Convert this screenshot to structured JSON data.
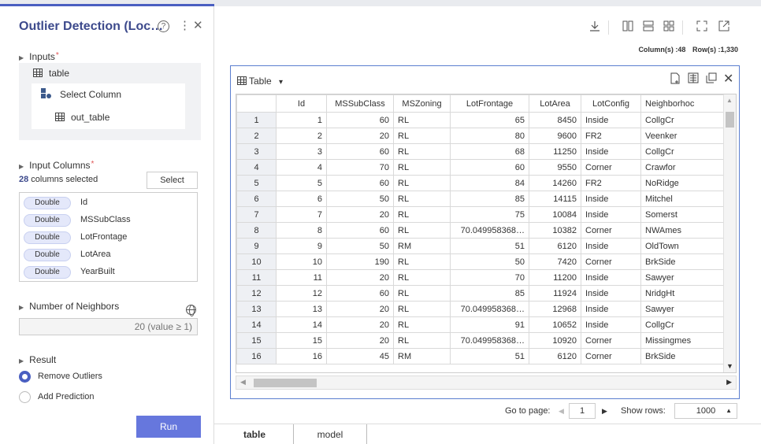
{
  "panel": {
    "title": "Outlier Detection (Loc…",
    "help_glyph": "?",
    "more_glyph": "⋮",
    "close_glyph": "✕",
    "inputs": {
      "label": "Inputs",
      "tree": {
        "root": "table",
        "node": "Select Column",
        "leaf": "out_table"
      }
    },
    "input_columns": {
      "label": "Input Columns",
      "count": "28",
      "count_suffix": " columns selected",
      "select_label": "Select",
      "items": [
        {
          "type": "Double",
          "name": "Id"
        },
        {
          "type": "Double",
          "name": "MSSubClass"
        },
        {
          "type": "Double",
          "name": "LotFrontage"
        },
        {
          "type": "Double",
          "name": "LotArea"
        },
        {
          "type": "Double",
          "name": "YearBuilt"
        }
      ]
    },
    "neighbors": {
      "label": "Number of Neighbors",
      "placeholder": "20 (value ≥ 1)"
    },
    "result": {
      "label": "Result",
      "options": [
        {
          "label": "Remove Outliers",
          "selected": true
        },
        {
          "label": "Add Prediction",
          "selected": false
        }
      ]
    },
    "run_label": "Run",
    "required_mark": "*"
  },
  "toolbar": {
    "icons": [
      "download-icon",
      "columns-layout-icon",
      "rows-layout-icon",
      "grid-layout-icon",
      "expand-icon",
      "popout-icon"
    ],
    "columns_label": "Column(s) :48",
    "rows_label": "Row(s) :1,330"
  },
  "table_view": {
    "title": "Table",
    "dropdown_glyph": "▾",
    "headers": [
      "",
      "Id",
      "MSSubClass",
      "MSZoning",
      "LotFrontage",
      "LotArea",
      "LotConfig",
      "Neighborhoc"
    ],
    "rows": [
      [
        "1",
        "1",
        "60",
        "RL",
        "65",
        "8450",
        "Inside",
        "CollgCr"
      ],
      [
        "2",
        "2",
        "20",
        "RL",
        "80",
        "9600",
        "FR2",
        "Veenker"
      ],
      [
        "3",
        "3",
        "60",
        "RL",
        "68",
        "11250",
        "Inside",
        "CollgCr"
      ],
      [
        "4",
        "4",
        "70",
        "RL",
        "60",
        "9550",
        "Corner",
        "Crawfor"
      ],
      [
        "5",
        "5",
        "60",
        "RL",
        "84",
        "14260",
        "FR2",
        "NoRidge"
      ],
      [
        "6",
        "6",
        "50",
        "RL",
        "85",
        "14115",
        "Inside",
        "Mitchel"
      ],
      [
        "7",
        "7",
        "20",
        "RL",
        "75",
        "10084",
        "Inside",
        "Somerst"
      ],
      [
        "8",
        "8",
        "60",
        "RL",
        "70.049958368…",
        "10382",
        "Corner",
        "NWAmes"
      ],
      [
        "9",
        "9",
        "50",
        "RM",
        "51",
        "6120",
        "Inside",
        "OldTown"
      ],
      [
        "10",
        "10",
        "190",
        "RL",
        "50",
        "7420",
        "Corner",
        "BrkSide"
      ],
      [
        "11",
        "11",
        "20",
        "RL",
        "70",
        "11200",
        "Inside",
        "Sawyer"
      ],
      [
        "12",
        "12",
        "60",
        "RL",
        "85",
        "11924",
        "Inside",
        "NridgHt"
      ],
      [
        "13",
        "13",
        "20",
        "RL",
        "70.049958368…",
        "12968",
        "Inside",
        "Sawyer"
      ],
      [
        "14",
        "14",
        "20",
        "RL",
        "91",
        "10652",
        "Inside",
        "CollgCr"
      ],
      [
        "15",
        "15",
        "20",
        "RL",
        "70.049958368…",
        "10920",
        "Corner",
        "Missingmes"
      ],
      [
        "16",
        "16",
        "45",
        "RM",
        "51",
        "6120",
        "Corner",
        "BrkSide"
      ]
    ]
  },
  "pager": {
    "goto_label": "Go to page:",
    "page": "1",
    "show_rows_label": "Show rows:",
    "rows_value": "1000"
  },
  "tabs": [
    {
      "label": "table",
      "active": true
    },
    {
      "label": "model",
      "active": false
    }
  ],
  "colors": {
    "accent": "#4a5fc1",
    "title": "#3d4a8c",
    "run_button": "#6677dd",
    "frame_border": "#5b7ed0"
  }
}
